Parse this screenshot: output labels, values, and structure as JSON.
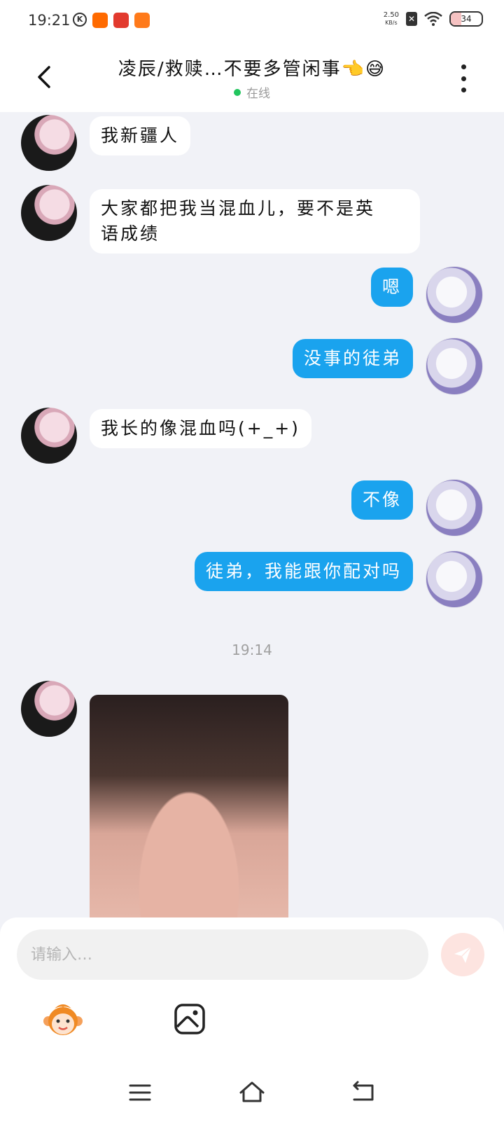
{
  "status_bar": {
    "time": "19:21",
    "net_speed_value": "2.50",
    "net_speed_unit": "KB/s",
    "battery": "34",
    "battery_level": 0.34
  },
  "header": {
    "title": "凌辰/救赎…不要多管闲事👈😅",
    "status": "在线"
  },
  "messages": [
    {
      "from": "other",
      "text": "我新疆人"
    },
    {
      "from": "other",
      "text_line1": "大家都把我当混血儿，要不是英",
      "text_line2": "语成绩"
    },
    {
      "from": "me",
      "text": "嗯"
    },
    {
      "from": "me",
      "text": "没事的徒弟"
    },
    {
      "from": "other",
      "text": "我长的像混血吗(+_+)"
    },
    {
      "from": "me",
      "text": "不像"
    },
    {
      "from": "me",
      "text": "徒弟，我能跟你配对吗"
    }
  ],
  "time_separator": "19:14",
  "composer": {
    "placeholder": "请输入…"
  },
  "colors": {
    "my_bubble": "#1aa3ee",
    "other_bubble": "#ffffff",
    "background": "#f1f2f7",
    "online": "#22c55e"
  }
}
